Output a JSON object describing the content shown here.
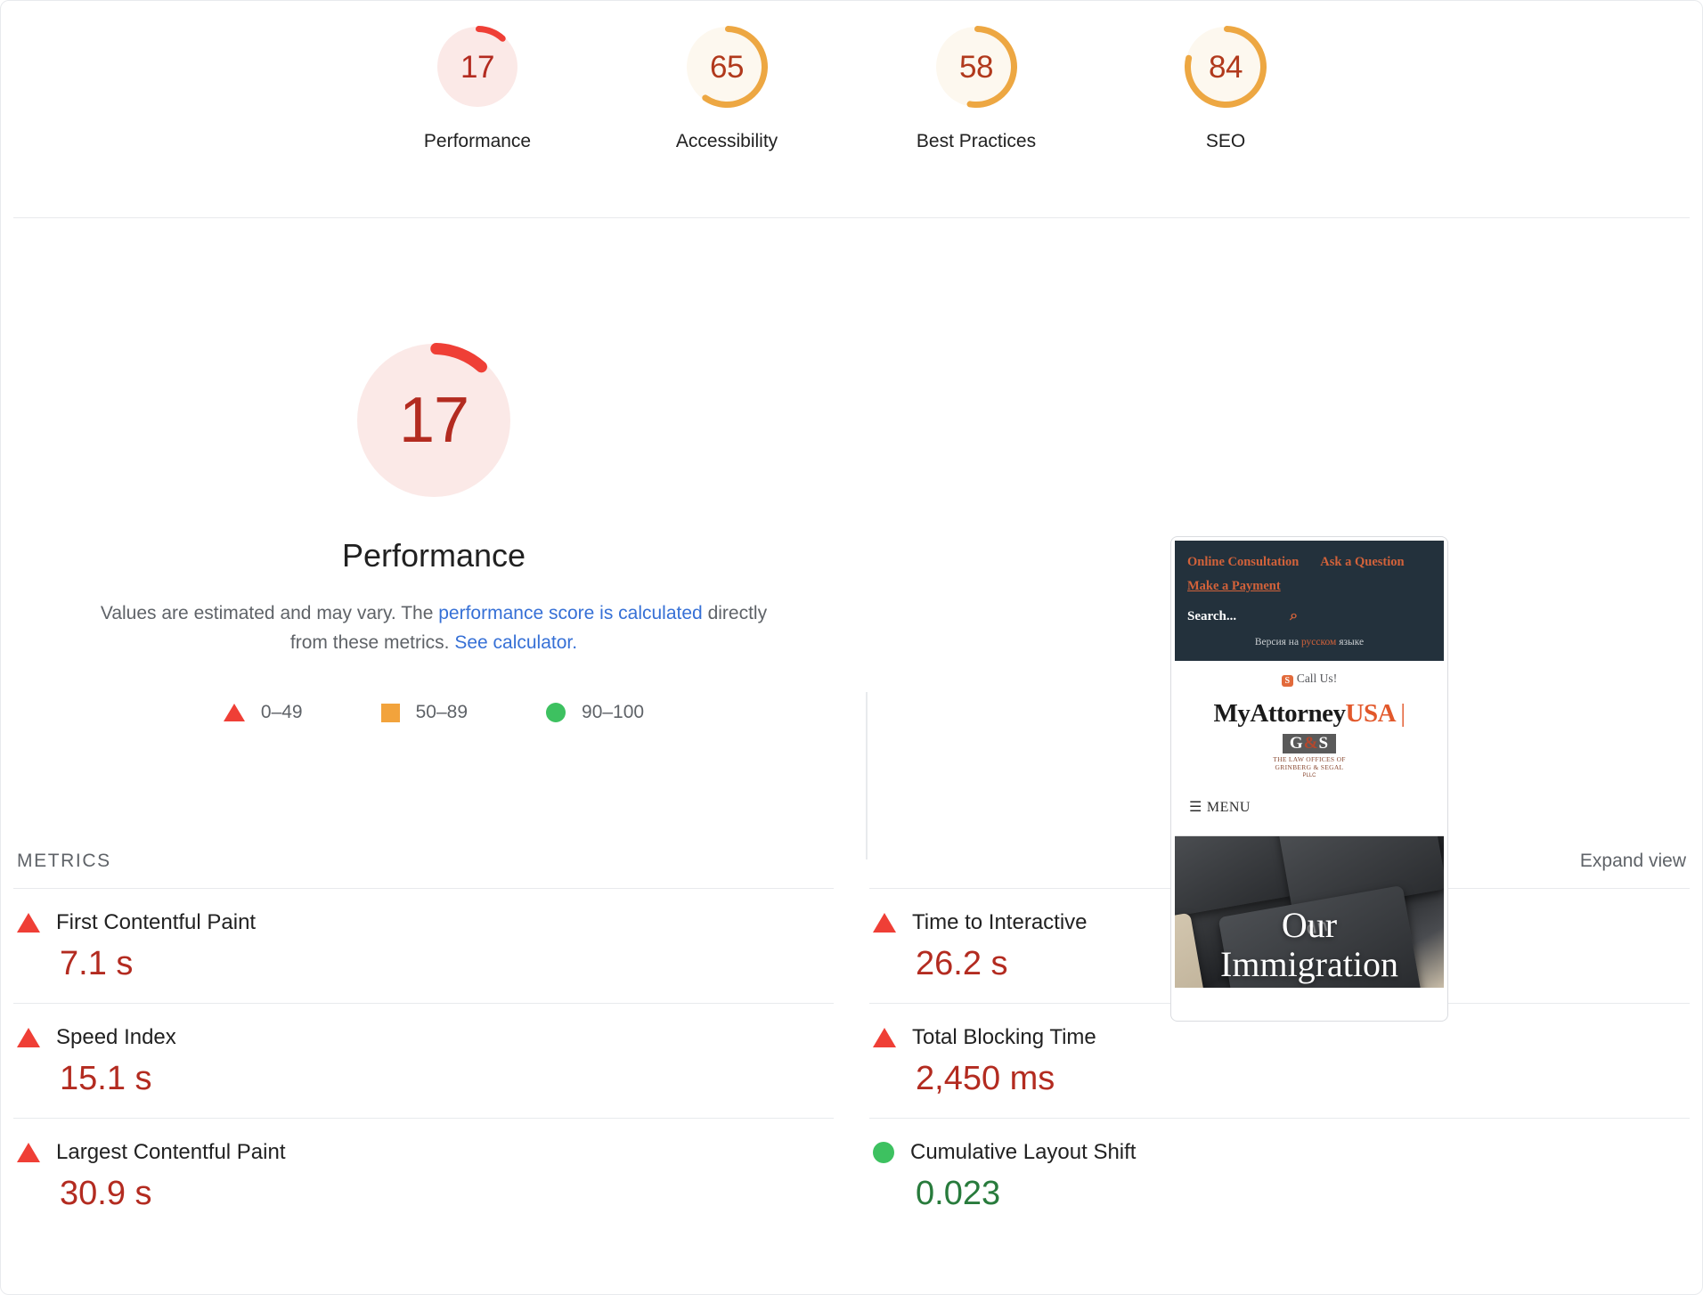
{
  "category_gauges": [
    {
      "score": "17",
      "label": "Performance",
      "rating": "fail",
      "color": "#ef3f36",
      "track": "#fbe9e7",
      "value_color": "#b32b20"
    },
    {
      "score": "65",
      "label": "Accessibility",
      "rating": "average",
      "color": "#eda742",
      "track": "#fdf8ef",
      "value_color": "#b1391c"
    },
    {
      "score": "58",
      "label": "Best Practices",
      "rating": "average",
      "color": "#eda742",
      "track": "#fdf8ef",
      "value_color": "#b1391c"
    },
    {
      "score": "84",
      "label": "SEO",
      "rating": "average",
      "color": "#eda742",
      "track": "#fdf8ef",
      "value_color": "#b1391c"
    }
  ],
  "performance": {
    "score": "17",
    "title": "Performance",
    "desc_prefix": "Values are estimated and may vary. The ",
    "desc_link1": "performance score is calculated",
    "desc_middle": " directly from these metrics. ",
    "desc_link2": "See calculator.",
    "gauge_color": "#ef3f36",
    "gauge_track": "#fbe9e7",
    "value_color": "#b32b20"
  },
  "legend": [
    {
      "shape": "triangle",
      "label": "0–49",
      "color": "#ef3f36"
    },
    {
      "shape": "square",
      "label": "50–89",
      "color": "#f2a33c"
    },
    {
      "shape": "circle",
      "label": "90–100",
      "color": "#3dc160"
    }
  ],
  "thumbnail": {
    "link_consultation": "Online Consultation",
    "link_question": "Ask a Question",
    "link_payment": "Make a Payment",
    "search_placeholder": "Search...",
    "search_icon": "⌕",
    "russian_prefix": "Версия на ",
    "russian_highlight": "русском",
    "russian_suffix": " языке",
    "call_badge": "S",
    "call_label": "Call Us!",
    "brand_main": "MyAttorney",
    "brand_accent": "USA",
    "brand_bar": "|",
    "logo_mark_left": "G",
    "logo_mark_amp": "&",
    "logo_mark_right": "S",
    "logo_sub_line1": "THE LAW OFFICES OF",
    "logo_sub_line2": "GRINBERG & SEGAL",
    "logo_sub_line3": "PLLC",
    "menu_icon": "☰",
    "menu_label": "MENU",
    "hero_key_glyph": "dn",
    "hero_title_line1": "Our",
    "hero_title_line2": "Immigration"
  },
  "metrics_section": {
    "title": "METRICS",
    "expand_label": "Expand view",
    "items": [
      {
        "name": "First Contentful Paint",
        "value": "7.1 s",
        "rating": "fail",
        "shape": "triangle"
      },
      {
        "name": "Time to Interactive",
        "value": "26.2 s",
        "rating": "fail",
        "shape": "triangle"
      },
      {
        "name": "Speed Index",
        "value": "15.1 s",
        "rating": "fail",
        "shape": "triangle"
      },
      {
        "name": "Total Blocking Time",
        "value": "2,450 ms",
        "rating": "fail",
        "shape": "triangle"
      },
      {
        "name": "Largest Contentful Paint",
        "value": "30.9 s",
        "rating": "fail",
        "shape": "triangle"
      },
      {
        "name": "Cumulative Layout Shift",
        "value": "0.023",
        "rating": "pass",
        "shape": "circle"
      }
    ]
  }
}
